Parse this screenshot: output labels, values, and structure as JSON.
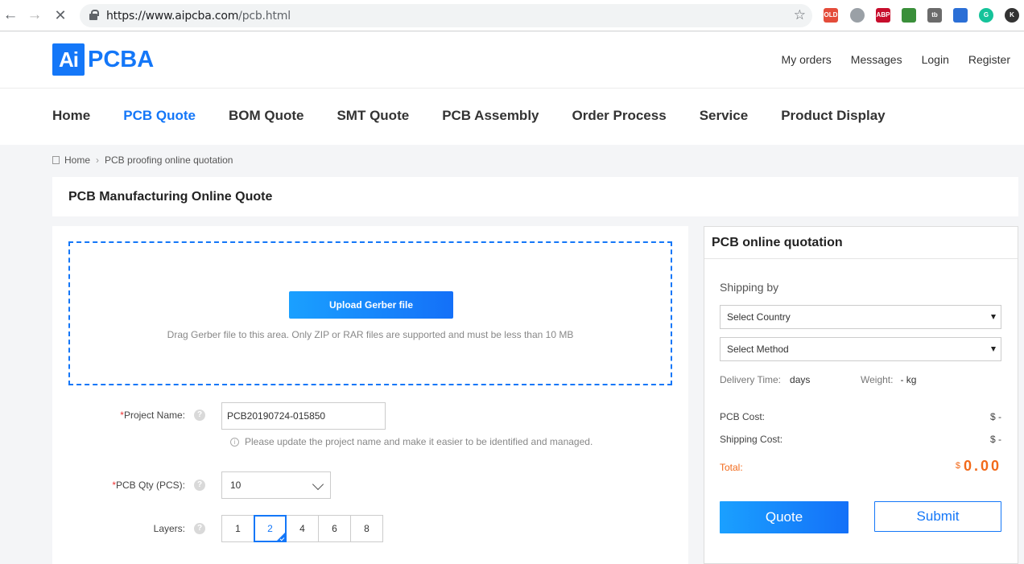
{
  "browser": {
    "url_host": "https://www.aipcba.com",
    "url_path": "/pcb.html",
    "extensions": [
      {
        "name": "old-reddit-icon",
        "label": "OLD",
        "color": "#e44c3a"
      },
      {
        "name": "globe-icon",
        "label": "",
        "color": "#9aa0a6"
      },
      {
        "name": "adblock-icon",
        "label": "ABP",
        "color": "#c70d2c"
      },
      {
        "name": "extension-icon",
        "label": "",
        "color": "#3a8f3a"
      },
      {
        "name": "tb-icon",
        "label": "tb",
        "color": "#6b6b6b"
      },
      {
        "name": "chart-icon",
        "label": "",
        "color": "#2b6fd6"
      },
      {
        "name": "grammarly-icon",
        "label": "G",
        "color": "#15c39a"
      },
      {
        "name": "profile-icon",
        "label": "K",
        "color": "#333333"
      }
    ]
  },
  "header": {
    "logo_ai": "Ai",
    "logo_pcba": "PCBA",
    "links": [
      "My orders",
      "Messages",
      "Login",
      "Register"
    ]
  },
  "nav": {
    "items": [
      "Home",
      "PCB Quote",
      "BOM Quote",
      "SMT Quote",
      "PCB Assembly",
      "Order Process",
      "Service",
      "Product Display"
    ],
    "active": "PCB Quote"
  },
  "breadcrumb": {
    "home": "Home",
    "current": "PCB proofing online quotation"
  },
  "page_title": "PCB Manufacturing Online Quote",
  "upload": {
    "button": "Upload Gerber file",
    "hint": "Drag Gerber file to this area. Only ZIP or RAR files are supported and must be less than 10 MB"
  },
  "form": {
    "project_name_label": "Project Name:",
    "project_name_value": "PCB20190724-015850",
    "project_name_hint": "Please update the project name and make it easier to be identified and managed.",
    "qty_label": "PCB Qty (PCS):",
    "qty_value": "10",
    "layers_label": "Layers:",
    "layers_options": [
      "1",
      "2",
      "4",
      "6",
      "8"
    ],
    "layers_selected": "2",
    "required_mark": "*",
    "help_glyph": "?",
    "info_glyph": "i"
  },
  "quotation": {
    "title": "PCB online quotation",
    "shipping_by": "Shipping by",
    "country_placeholder": "Select Country",
    "method_placeholder": "Select Method",
    "delivery_label": "Delivery Time:",
    "delivery_value": "days",
    "weight_label": "Weight:",
    "weight_value": "- kg",
    "pcb_cost_label": "PCB Cost:",
    "pcb_cost_value": "$ -",
    "shipping_cost_label": "Shipping Cost:",
    "shipping_cost_value": "$ -",
    "total_label": "Total:",
    "total_currency": "$",
    "total_value": "0.00",
    "quote_button": "Quote",
    "submit_button": "Submit"
  }
}
